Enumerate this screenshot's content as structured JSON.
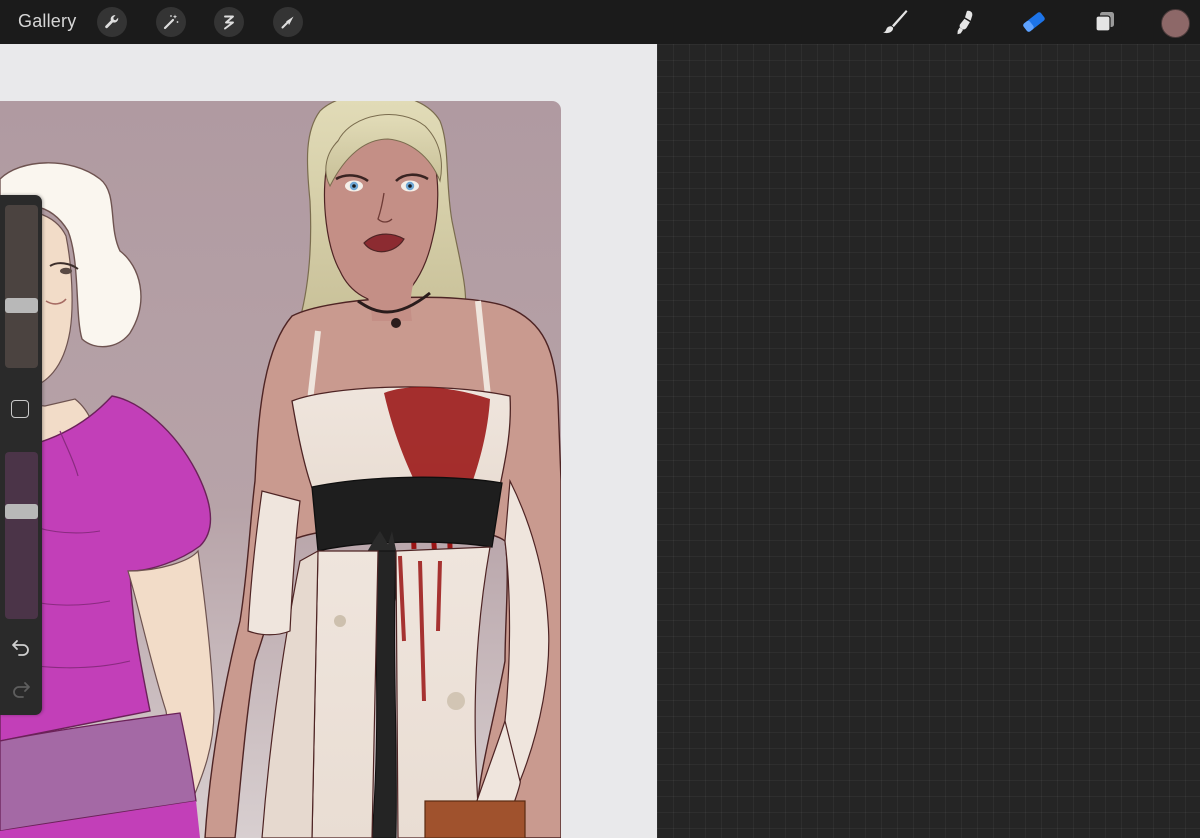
{
  "toolbar": {
    "gallery_label": "Gallery",
    "left_tools": [
      "wrench-icon",
      "magic-wand-icon",
      "selection-icon",
      "transform-arrow-icon"
    ],
    "right_tools": [
      "brush-icon",
      "smudge-icon",
      "eraser-icon",
      "layers-icon"
    ],
    "active_tool": "eraser-icon",
    "active_color": "#8d6868",
    "accent_color": "#1d74e8"
  },
  "sidebar": {
    "brush_size": 0.37,
    "opacity": 0.66,
    "undo_icon": "undo-icon",
    "redo_icon": "redo-icon"
  },
  "canvas": {
    "background_color": "#e9e9eb",
    "workspace_color": "#252525",
    "artwork_background": "#b39aa0"
  }
}
